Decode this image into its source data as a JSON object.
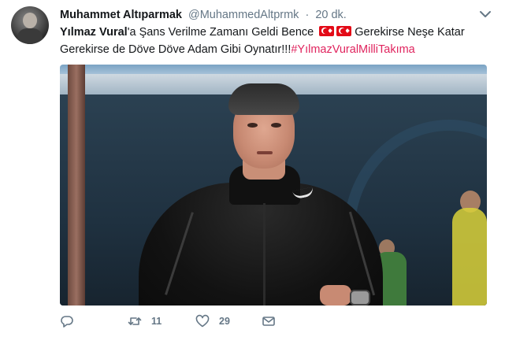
{
  "tweet": {
    "author_name": "Muhammet Altıparmak",
    "handle": "@MuhammedAltprmk",
    "separator": "·",
    "time": "20 dk.",
    "text_mention": "Yılmaz Vural",
    "text_part1": "'a Şans Verilme Zamanı Geldi Bence",
    "text_part2": "Gerekirse Neşe Katar Gerekirse de Döve Döve Adam Gibi Oynatır!!!",
    "hashtag": "#YılmazVuralMilliTakıma",
    "emoji_flags": [
      "turkey-flag",
      "turkey-flag"
    ],
    "colors": {
      "hashtag": "#e0245e",
      "secondary": "#657786",
      "text": "#14171a"
    }
  },
  "actions": {
    "reply_count": "",
    "retweet_count": "11",
    "like_count": "29",
    "icons": [
      "reply-icon",
      "retweet-icon",
      "like-icon",
      "direct-message-icon"
    ]
  }
}
